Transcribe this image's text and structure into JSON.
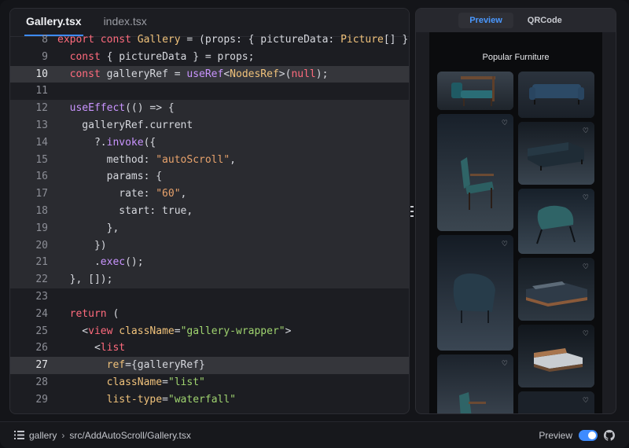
{
  "editor": {
    "tabs": [
      {
        "label": "Gallery.tsx",
        "active": true
      },
      {
        "label": "index.tsx",
        "active": false
      }
    ],
    "lines": [
      {
        "num": "8",
        "text": "export const Gallery = (props: { pictureData: Picture[] })"
      },
      {
        "num": "9",
        "text": "  const { pictureData } = props;"
      },
      {
        "num": "10",
        "text": "  const galleryRef = useRef<NodesRef>(null);"
      },
      {
        "num": "11",
        "text": ""
      },
      {
        "num": "12",
        "text": "  useEffect(() => {"
      },
      {
        "num": "13",
        "text": "    galleryRef.current"
      },
      {
        "num": "14",
        "text": "      ?.invoke({"
      },
      {
        "num": "15",
        "text": "        method: \"autoScroll\","
      },
      {
        "num": "16",
        "text": "        params: {"
      },
      {
        "num": "17",
        "text": "          rate: \"60\","
      },
      {
        "num": "18",
        "text": "          start: true,"
      },
      {
        "num": "19",
        "text": "        },"
      },
      {
        "num": "20",
        "text": "      })"
      },
      {
        "num": "21",
        "text": "      .exec();"
      },
      {
        "num": "22",
        "text": "  }, []);"
      },
      {
        "num": "23",
        "text": ""
      },
      {
        "num": "24",
        "text": "  return ("
      },
      {
        "num": "25",
        "text": "    <view className=\"gallery-wrapper\">"
      },
      {
        "num": "26",
        "text": "      <list"
      },
      {
        "num": "27",
        "text": "        ref={galleryRef}"
      },
      {
        "num": "28",
        "text": "        className=\"list\""
      },
      {
        "num": "29",
        "text": "        list-type=\"waterfall\""
      }
    ]
  },
  "preview": {
    "tabs": [
      {
        "label": "Preview",
        "active": true
      },
      {
        "label": "QRCode",
        "active": false
      }
    ],
    "title": "Popular Furniture",
    "heart_glyph": "♡"
  },
  "status": {
    "project": "gallery",
    "path": "src/AddAutoScroll/Gallery.tsx",
    "preview_label": "Preview",
    "preview_enabled": true
  },
  "colors": {
    "accent": "#3d8bff",
    "keyword": "#ff6b7d",
    "function": "#c994ff",
    "string": "#e9a36c",
    "jsx_string": "#9fd36f"
  }
}
